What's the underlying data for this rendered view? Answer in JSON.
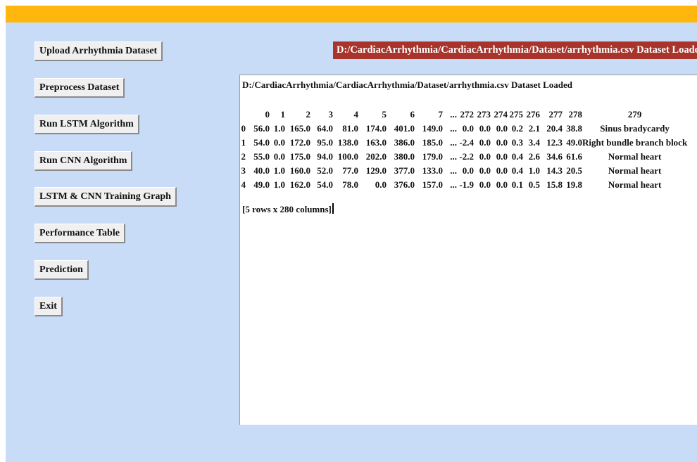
{
  "buttons": {
    "upload": "Upload Arrhythmia Dataset",
    "preprocess": "Preprocess Dataset",
    "lstm": "Run LSTM Algorithm",
    "cnn": "Run CNN Algorithm",
    "graph": "LSTM & CNN Training Graph",
    "performance": "Performance Table",
    "prediction": "Prediction",
    "exit": "Exit"
  },
  "status_label": "D:/CardiacArrhythmia/CardiacArrhythmia/Dataset/arrhythmia.csv Dataset Loaded",
  "output": {
    "path_line": "D:/CardiacArrhythmia/CardiacArrhythmia/Dataset/arrhythmia.csv Dataset Loaded",
    "columns": [
      "0",
      "1",
      "2",
      "3",
      "4",
      "5",
      "6",
      "7",
      "...",
      "272",
      "273",
      "274",
      "275",
      "276",
      "277",
      "278",
      "279"
    ],
    "rows": [
      [
        "0",
        "56.0",
        "1.0",
        "165.0",
        "64.0",
        "81.0",
        "174.0",
        "401.0",
        "149.0",
        "...",
        "0.0",
        "0.0",
        "0.0",
        "0.2",
        "2.1",
        "20.4",
        "38.8",
        "Sinus bradycardy"
      ],
      [
        "1",
        "54.0",
        "0.0",
        "172.0",
        "95.0",
        "138.0",
        "163.0",
        "386.0",
        "185.0",
        "...",
        "-2.4",
        "0.0",
        "0.0",
        "0.3",
        "3.4",
        "12.3",
        "49.0",
        "Right bundle branch block"
      ],
      [
        "2",
        "55.0",
        "0.0",
        "175.0",
        "94.0",
        "100.0",
        "202.0",
        "380.0",
        "179.0",
        "...",
        "-2.2",
        "0.0",
        "0.0",
        "0.4",
        "2.6",
        "34.6",
        "61.6",
        "Normal heart"
      ],
      [
        "3",
        "40.0",
        "1.0",
        "160.0",
        "52.0",
        "77.0",
        "129.0",
        "377.0",
        "133.0",
        "...",
        "0.0",
        "0.0",
        "0.0",
        "0.4",
        "1.0",
        "14.3",
        "20.5",
        "Normal heart"
      ],
      [
        "4",
        "49.0",
        "1.0",
        "162.0",
        "54.0",
        "78.0",
        "0.0",
        "376.0",
        "157.0",
        "...",
        "-1.9",
        "0.0",
        "0.0",
        "0.1",
        "0.5",
        "15.8",
        "19.8",
        "Normal heart"
      ]
    ],
    "footer": "[5 rows x 280 columns]"
  }
}
